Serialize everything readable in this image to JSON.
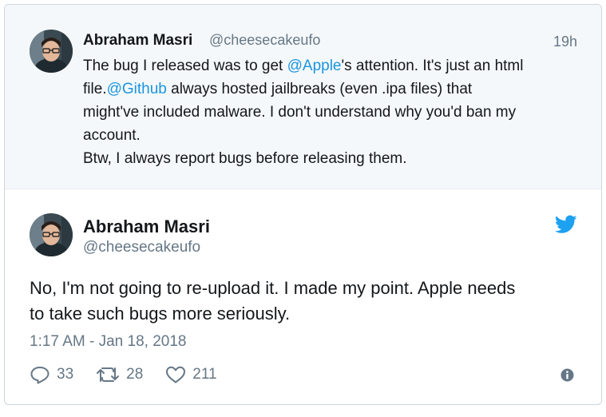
{
  "parent_tweet": {
    "name": "Abraham Masri",
    "handle": "@cheesecakeufo",
    "time": "19h",
    "line1_a": "The bug I released was to get ",
    "line1_mention": "@Apple",
    "line1_b": "'s attention. It's just an html",
    "line2_a": "file.",
    "line2_mention": "@Github",
    "line2_b": " always hosted jailbreaks (even .ipa files) that",
    "line3": "might've included malware. I don't understand why you'd ban my",
    "line4": "account.",
    "line5": "Btw, I always report bugs before releasing them."
  },
  "main_tweet": {
    "name": "Abraham Masri",
    "handle": "@cheesecakeufo",
    "text_line1": "No, I'm not going to re-upload it. I made my point. Apple needs",
    "text_line2": "to take such bugs more seriously.",
    "date": "1:17 AM - Jan 18, 2018",
    "replies": "33",
    "retweets": "28",
    "likes": "211"
  },
  "icons": {
    "brand": "twitter-bird-icon",
    "reply": "reply-icon",
    "retweet": "retweet-icon",
    "like": "heart-icon",
    "info": "info-icon"
  },
  "colors": {
    "link": "#1b95e0",
    "secondary_text": "#657786",
    "parent_background": "#f5f8fa"
  }
}
